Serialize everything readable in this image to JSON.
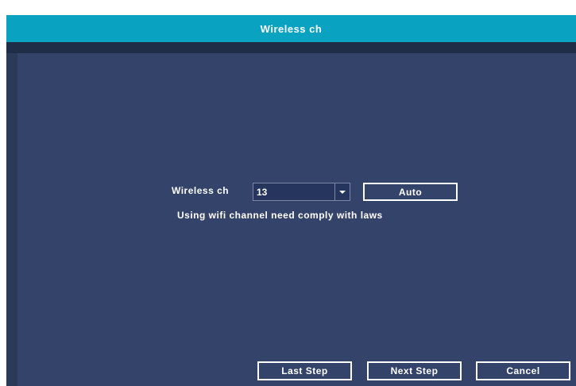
{
  "window": {
    "title": "Wireless  ch"
  },
  "form": {
    "channel_label": "Wireless  ch",
    "channel_value": "13",
    "auto_button": "Auto",
    "notice": "Using  wifi  channel  need  comply  with  laws"
  },
  "footer": {
    "last_step": "Last  Step",
    "next_step": "Next  Step",
    "cancel": "Cancel"
  },
  "colors": {
    "titlebar": "#0aa2c1",
    "background": "#344369",
    "strip": "#1f2d47"
  }
}
